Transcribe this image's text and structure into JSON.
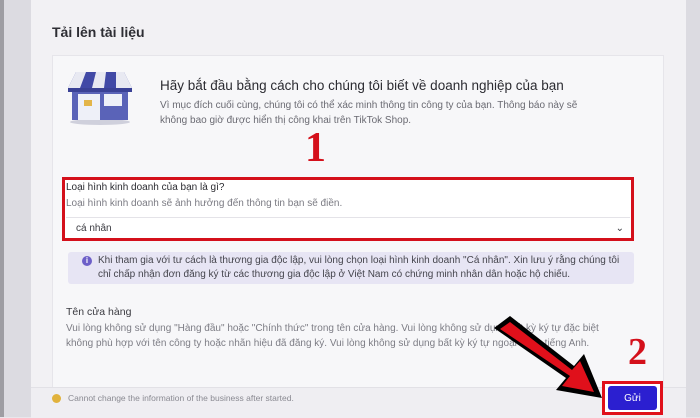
{
  "page": {
    "title": "Tải lên tài liệu"
  },
  "intro": {
    "title": "Hãy bắt đầu bằng cách cho chúng tôi biết về doanh nghiệp của bạn",
    "description": "Vì mục đích cuối cùng, chúng tôi có thể xác minh thông tin công ty của bạn. Thông báo này sẽ không bao giờ được hiển thị công khai trên TikTok Shop.",
    "icon": "store-icon"
  },
  "business_type": {
    "label": "Loại hình kinh doanh của bạn là gì?",
    "hint": "Loại hình kinh doanh sẽ ảnh hưởng đến thông tin bạn sẽ điền.",
    "selected": "cá nhân",
    "chevron_icon": "chevron-down-icon"
  },
  "notice": {
    "icon": "info-icon",
    "text": "Khi tham gia với tư cách là thương gia độc lập, vui lòng chọn loại hình kinh doanh \"Cá nhân\". Xin lưu ý rằng chúng tôi chỉ chấp nhận đơn đăng ký từ các thương gia độc lập ở Việt Nam có chứng minh nhân dân hoặc hộ chiếu."
  },
  "store_name": {
    "label": "Tên cửa hàng",
    "description": "Vui lòng không sử dụng \"Hàng đầu\" hoặc \"Chính thức\" trong tên cửa hàng. Vui lòng không sử dụng bất kỳ ký tự đặc biệt không phù hợp với tên công ty hoặc nhãn hiệu đã đăng ký. Vui lòng không sử dụng bất kỳ ký tự ngoại ký tự tiếng Anh."
  },
  "footer": {
    "text": "Cannot change the information of the business after started."
  },
  "actions": {
    "submit_label": "Gửi"
  },
  "annotations": {
    "step1": "1",
    "step2": "2",
    "color": "#d4101b"
  },
  "colors": {
    "accent": "#2b1fd0",
    "highlight": "#d4101b",
    "notice_bg": "#e7e5f4"
  }
}
